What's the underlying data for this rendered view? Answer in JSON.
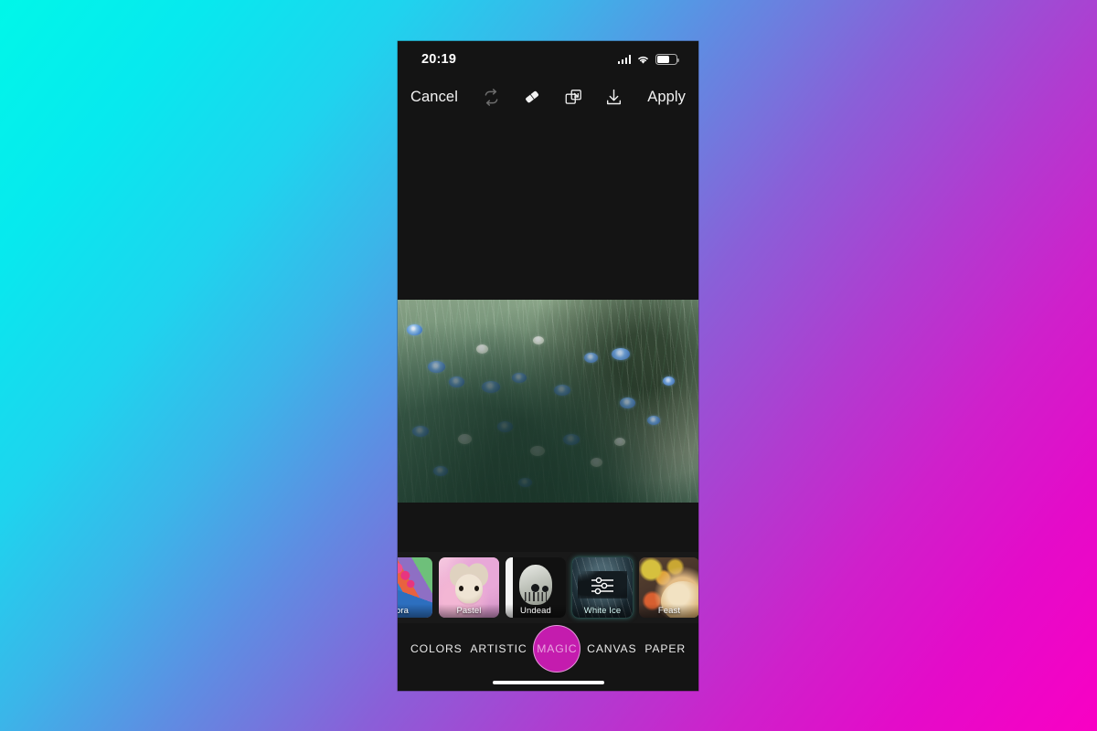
{
  "background": {
    "gradient_from": "#00f7e9",
    "gradient_to": "#f900c4",
    "description": "cyan to magenta diagonal gradient"
  },
  "phone": {
    "screen_bg": "#141414"
  },
  "status_bar": {
    "time": "20:19",
    "signal_icon": "cellular-signal-icon",
    "wifi_icon": "wifi-icon",
    "battery_icon": "battery-icon",
    "battery_level": "68"
  },
  "toolbar": {
    "cancel_label": "Cancel",
    "apply_label": "Apply",
    "icons": [
      {
        "name": "loop-icon",
        "state": "dimmed"
      },
      {
        "name": "eraser-icon",
        "state": "active"
      },
      {
        "name": "layers-transform-icon",
        "state": "active"
      },
      {
        "name": "download-icon",
        "state": "active"
      }
    ]
  },
  "canvas": {
    "photo_alt": "blue cornflowers in green grass"
  },
  "filters": {
    "items": [
      {
        "label": "ora",
        "full_label": "Flora",
        "selected": false,
        "art": "art-flora"
      },
      {
        "label": "Pastel",
        "selected": false,
        "art": "art-pastel"
      },
      {
        "label": "Undead",
        "selected": false,
        "art": "art-undead"
      },
      {
        "label": "White Ice",
        "selected": true,
        "art": "art-white-ice"
      },
      {
        "label": "Feast",
        "selected": false,
        "art": "art-feast"
      }
    ],
    "selected_border_color": "#56e0d8",
    "adjust_icon": "sliders-icon"
  },
  "tabbar": {
    "tabs": [
      {
        "label": "COLORS",
        "active": false
      },
      {
        "label": "ARTISTIC",
        "active": false
      },
      {
        "label": "MAGIC",
        "active": true
      },
      {
        "label": "CANVAS",
        "active": false
      },
      {
        "label": "PAPER",
        "active": false
      }
    ],
    "active_color": "#c41cae",
    "home_indicator": true
  }
}
